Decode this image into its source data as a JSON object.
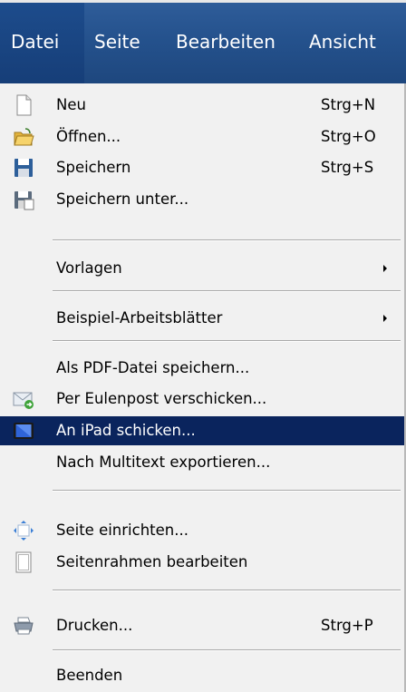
{
  "menubar": {
    "tabs": [
      "Datei",
      "Seite",
      "Bearbeiten",
      "Ansicht"
    ],
    "active_tab": "Datei"
  },
  "menu": {
    "items": [
      {
        "label": "Neu",
        "shortcut": "Strg+N",
        "icon": "new-document-icon"
      },
      {
        "label": "Öffnen...",
        "shortcut": "Strg+O",
        "icon": "open-folder-icon"
      },
      {
        "label": "Speichern",
        "shortcut": "Strg+S",
        "icon": "save-floppy-icon"
      },
      {
        "label": "Speichern unter...",
        "shortcut": "",
        "icon": "save-as-floppy-icon"
      },
      {
        "label": "Vorlagen",
        "submenu": true
      },
      {
        "label": "Beispiel-Arbeitsblätter",
        "submenu": true
      },
      {
        "label": "Als PDF-Datei speichern..."
      },
      {
        "label": "Per Eulenpost verschicken...",
        "icon": "mail-send-icon"
      },
      {
        "label": "An iPad schicken...",
        "icon": "ipad-icon",
        "highlighted": true
      },
      {
        "label": "Nach Multitext exportieren..."
      },
      {
        "label": "Seite einrichten...",
        "icon": "page-setup-icon"
      },
      {
        "label": "Seitenrahmen bearbeiten",
        "icon": "page-frame-icon"
      },
      {
        "label": "Drucken...",
        "shortcut": "Strg+P",
        "icon": "printer-icon"
      },
      {
        "label": "Beenden"
      }
    ]
  },
  "colors": {
    "menubar": "#24518c",
    "highlight": "#0a245d",
    "menu_background": "#f1f1f1"
  }
}
